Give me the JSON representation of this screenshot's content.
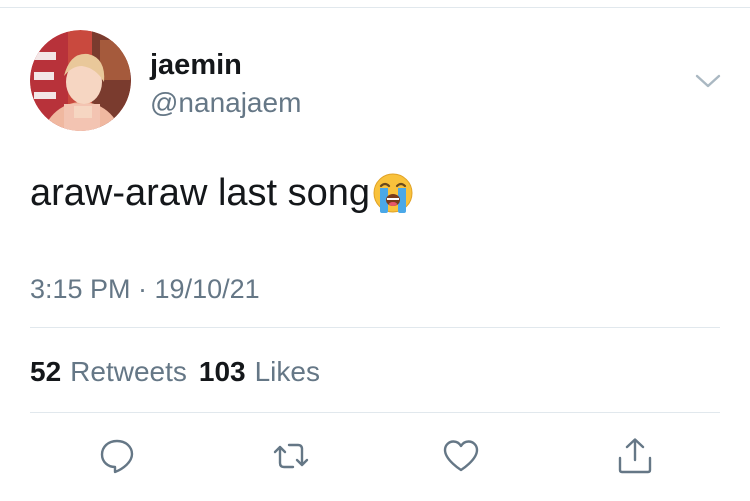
{
  "tweet": {
    "author": {
      "display_name": "jaemin",
      "handle": "@nanajaem"
    },
    "text": "araw-araw last song",
    "emoji": "loudly-crying-face",
    "timestamp": "3:15 PM · 19/10/21",
    "stats": {
      "retweets_count": "52",
      "retweets_label": "Retweets",
      "likes_count": "103",
      "likes_label": "Likes"
    }
  },
  "actions": [
    "reply-icon",
    "retweet-icon",
    "like-icon",
    "share-icon"
  ],
  "colors": {
    "text_primary": "#14171a",
    "text_secondary": "#657786",
    "divider": "#e1e8ed",
    "icon": "#657786"
  }
}
